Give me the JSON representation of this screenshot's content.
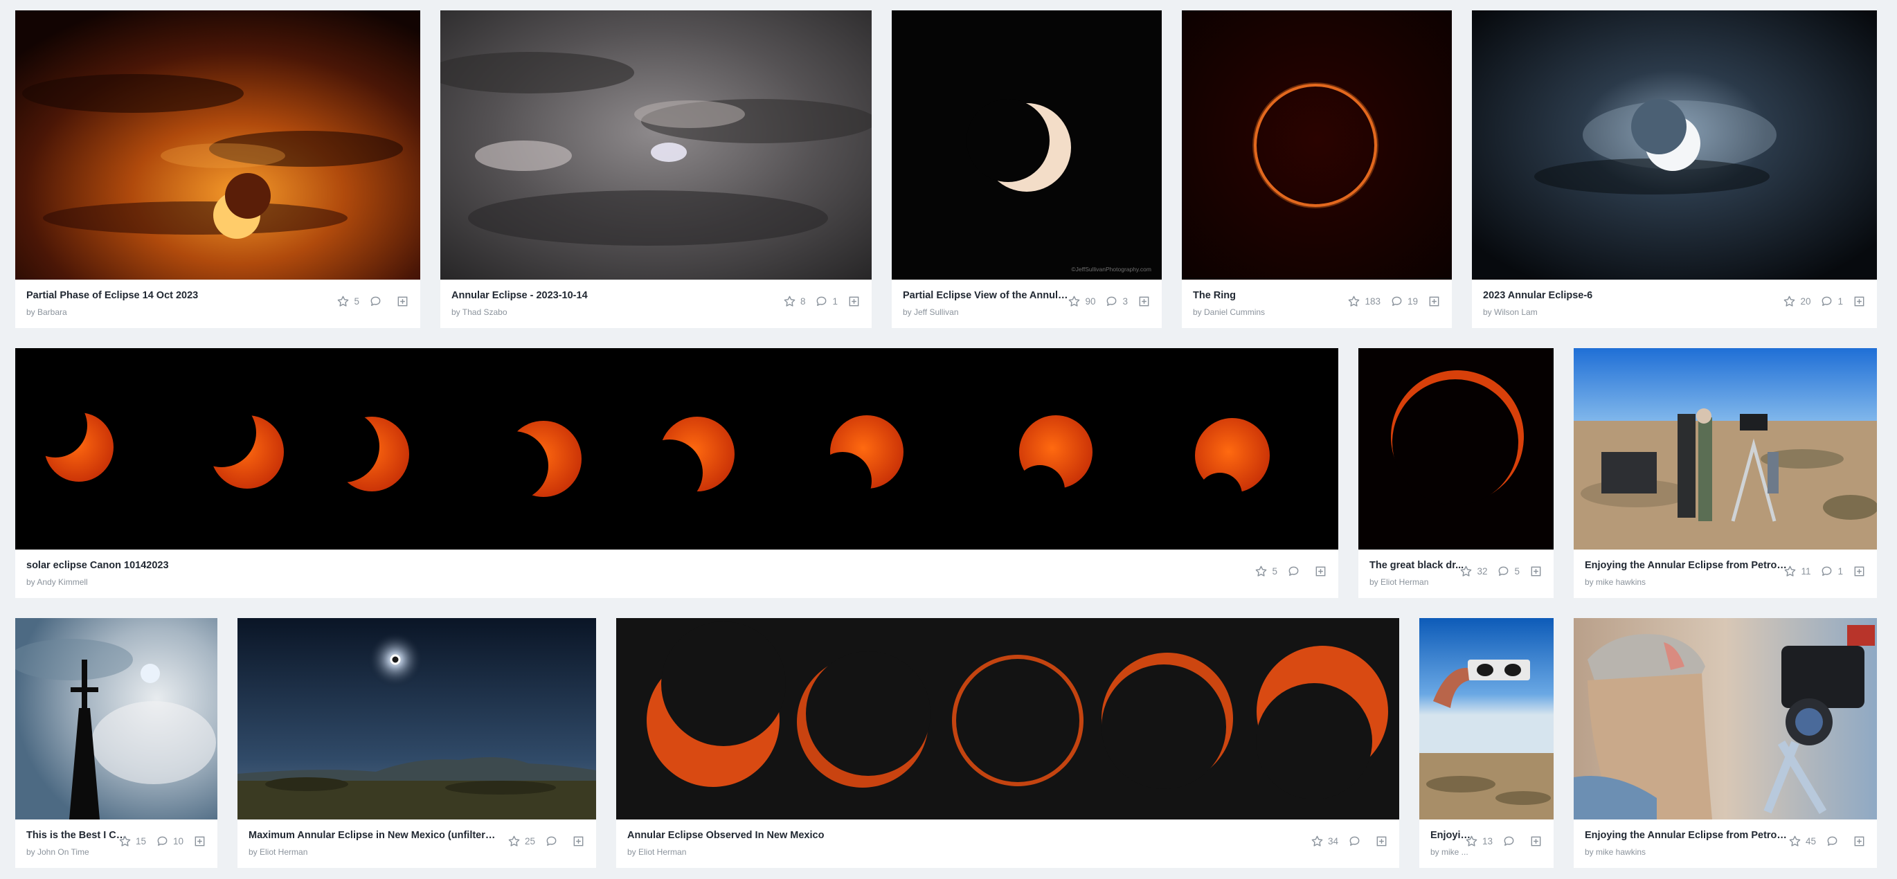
{
  "photos": [
    {
      "id": "p1",
      "title": "Partial Phase of Eclipse 14 Oct 2023",
      "author": "by Barbara",
      "likes": "5",
      "comments": ""
    },
    {
      "id": "p2",
      "title": "Annular Eclipse - 2023-10-14",
      "author": "by Thad Szabo",
      "likes": "8",
      "comments": "1"
    },
    {
      "id": "p3",
      "title": "Partial Eclipse View of the Annular E...",
      "author": "by Jeff Sullivan",
      "likes": "90",
      "comments": "3"
    },
    {
      "id": "p4",
      "title": "The Ring",
      "author": "by Daniel Cummins",
      "likes": "183",
      "comments": "19"
    },
    {
      "id": "p5",
      "title": "2023 Annular Eclipse-6",
      "author": "by Wilson Lam",
      "likes": "20",
      "comments": "1"
    },
    {
      "id": "p6",
      "title": "solar eclipse Canon 10142023",
      "author": "by Andy Kimmell",
      "likes": "5",
      "comments": ""
    },
    {
      "id": "p7",
      "title": "The great black dr...",
      "author": "by Eliot Herman",
      "likes": "32",
      "comments": "5"
    },
    {
      "id": "p8",
      "title": "Enjoying the Annular Eclipse from Petroglyph...",
      "author": "by mike hawkins",
      "likes": "11",
      "comments": "1"
    },
    {
      "id": "p9",
      "title": "This is the Best I Co...",
      "author": "by John On Time",
      "likes": "15",
      "comments": "10"
    },
    {
      "id": "p10",
      "title": "Maximum Annular Eclipse in New Mexico (unfiltered)",
      "author": "by Eliot Herman",
      "likes": "25",
      "comments": ""
    },
    {
      "id": "p11",
      "title": "Annular Eclipse Observed In New Mexico",
      "author": "by Eliot Herman",
      "likes": "34",
      "comments": ""
    },
    {
      "id": "p12",
      "title": "Enjoyin...",
      "author": "by mike ...",
      "likes": "13",
      "comments": ""
    },
    {
      "id": "p13",
      "title": "Enjoying the Annular Eclipse from Petroglyph...",
      "author": "by mike hawkins",
      "likes": "45",
      "comments": ""
    }
  ],
  "watermarks": {
    "p3": "©JeffSullivanPhotography.com"
  },
  "icons": {
    "like": "star-icon",
    "comment": "comment-icon",
    "add": "add-to-gallery-icon"
  },
  "colors": {
    "background": "#eef1f4",
    "card": "#ffffff",
    "title": "#222933",
    "muted": "#8b939c"
  }
}
